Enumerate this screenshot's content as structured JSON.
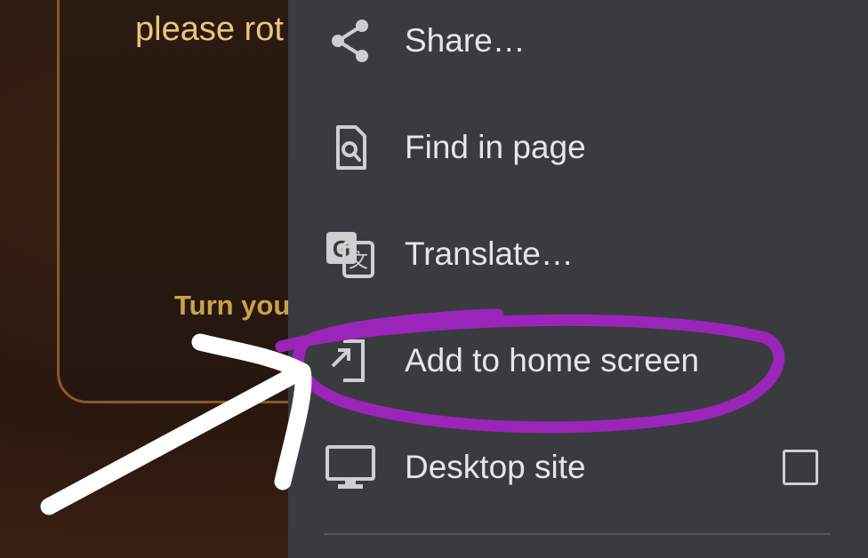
{
  "background_page": {
    "rotate_text": "please rot",
    "turn_text": "Turn you"
  },
  "menu": {
    "items": [
      {
        "label": "Share…",
        "icon": "share-icon"
      },
      {
        "label": "Find in page",
        "icon": "find-in-page-icon"
      },
      {
        "label": "Translate…",
        "icon": "translate-icon"
      },
      {
        "label": "Add to home screen",
        "icon": "add-to-home-screen-icon"
      },
      {
        "label": "Desktop site",
        "icon": "desktop-icon",
        "checkbox_checked": false
      }
    ]
  },
  "annotations": {
    "highlight_color": "#9b25b8",
    "arrow_color": "#ffffff"
  }
}
